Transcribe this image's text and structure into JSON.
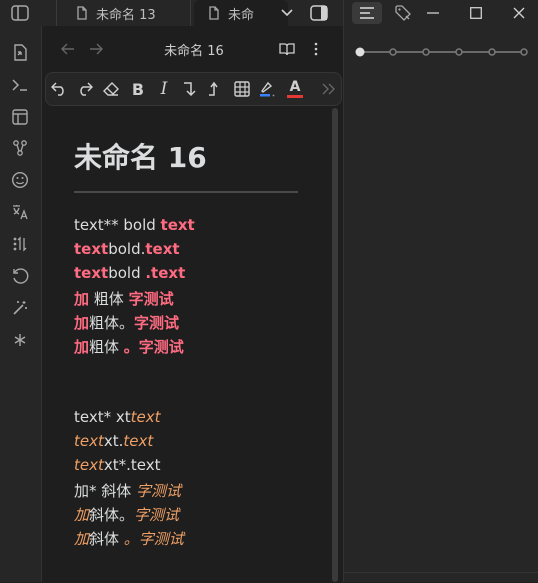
{
  "tabs": [
    {
      "label": "未命名 13",
      "active": false
    },
    {
      "label": "未命",
      "active": true
    }
  ],
  "sidebar": {
    "icons": [
      "open-file-icon",
      "terminal-icon",
      "templates-icon",
      "graph-icon",
      "emoji-icon",
      "translate-icon",
      "reading-view-icon",
      "history-icon",
      "magic-wand-icon",
      "asterisk-icon"
    ]
  },
  "nav": {
    "title": "未命名 16"
  },
  "toolbar": {
    "icons": [
      "undo-icon",
      "redo-icon",
      "eraser-icon",
      "bold-icon",
      "italic-icon",
      "line-break-icon",
      "return-icon",
      "table-icon",
      "highlight-icon",
      "text-color-icon",
      "more-icon"
    ],
    "bold_glyph": "B",
    "italic_glyph": "I",
    "font_color_glyph": "A"
  },
  "document": {
    "title": "未命名 16",
    "lines": [
      [
        {
          "t": "text** bold ",
          "s": "n"
        },
        {
          "t": "text",
          "s": "rb"
        }
      ],
      [
        {
          "t": "text",
          "s": "rb"
        },
        {
          "t": "bold.",
          "s": "n"
        },
        {
          "t": "text",
          "s": "rb"
        }
      ],
      [
        {
          "t": "text",
          "s": "rb"
        },
        {
          "t": "bold ",
          "s": "n"
        },
        {
          "t": ".text",
          "s": "rb"
        }
      ],
      [
        {
          "t": "加",
          "s": "rb"
        },
        {
          "t": " 粗体 ",
          "s": "n"
        },
        {
          "t": "字测试",
          "s": "rb"
        }
      ],
      [
        {
          "t": "加",
          "s": "rb"
        },
        {
          "t": "粗体。",
          "s": "n"
        },
        {
          "t": "字测试",
          "s": "rb"
        }
      ],
      [
        {
          "t": "加",
          "s": "rb"
        },
        {
          "t": "粗体 ",
          "s": "n"
        },
        {
          "t": "。字测试",
          "s": "rb"
        }
      ],
      [
        {
          "t": "text* xt",
          "s": "n"
        },
        {
          "t": "text",
          "s": "oi"
        }
      ],
      [
        {
          "t": "text",
          "s": "oi"
        },
        {
          "t": "xt.",
          "s": "n"
        },
        {
          "t": "text",
          "s": "oi"
        }
      ],
      [
        {
          "t": "text",
          "s": "oi"
        },
        {
          "t": "xt*.text",
          "s": "n"
        }
      ],
      [
        {
          "t": "加* 斜体 ",
          "s": "n"
        },
        {
          "t": "字测试",
          "s": "oi"
        }
      ],
      [
        {
          "t": "加",
          "s": "oi"
        },
        {
          "t": "斜体。",
          "s": "n"
        },
        {
          "t": "字测试",
          "s": "oi"
        }
      ],
      [
        {
          "t": "加",
          "s": "oi"
        },
        {
          "t": "斜体 ",
          "s": "n"
        },
        {
          "t": "。字测试",
          "s": "oi"
        }
      ]
    ]
  },
  "colors": {
    "accent_bold": "#ff6b81",
    "accent_italic": "#f0a066",
    "background": "#1e1e1e",
    "panel": "#262626"
  }
}
